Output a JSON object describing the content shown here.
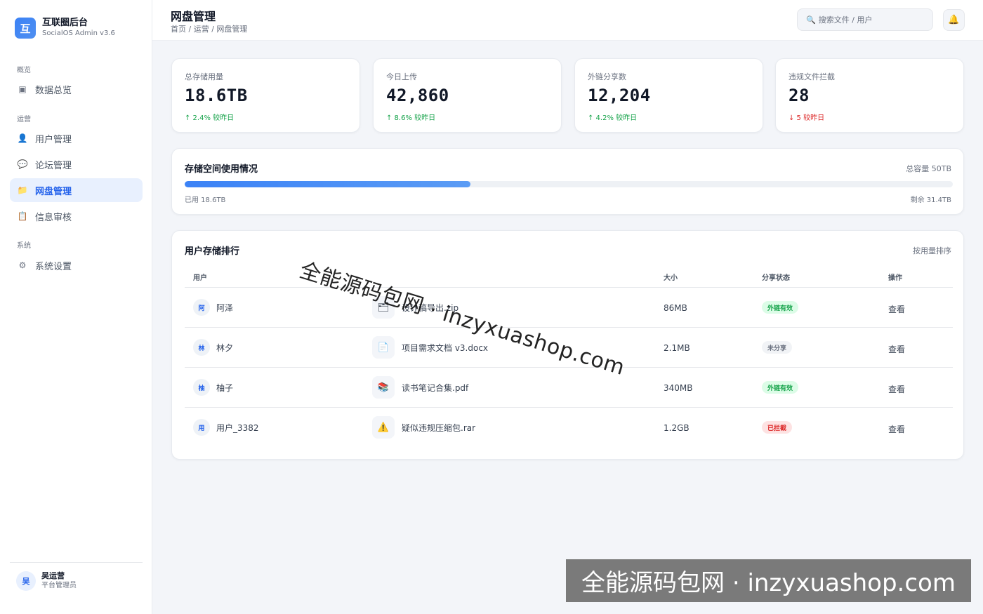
{
  "brand": {
    "logo_char": "互",
    "title": "互联圈后台",
    "subtitle": "SocialOS Admin v3.6"
  },
  "sidebar": {
    "groups": [
      {
        "label": "概览"
      },
      {
        "label": "运营"
      },
      {
        "label": "系统"
      }
    ],
    "items": [
      {
        "icon": "▣",
        "icon_name": "dashboard-icon",
        "label": "数据总览"
      },
      {
        "icon": "👤",
        "icon_name": "user-icon",
        "label": "用户管理"
      },
      {
        "icon": "💬",
        "icon_name": "forum-icon",
        "label": "论坛管理"
      },
      {
        "icon": "📁",
        "icon_name": "folder-icon",
        "label": "网盘管理"
      },
      {
        "icon": "📋",
        "icon_name": "clipboard-icon",
        "label": "信息审核"
      },
      {
        "icon": "⚙",
        "icon_name": "gear-icon",
        "label": "系统设置"
      }
    ],
    "active_item": "网盘管理"
  },
  "profile": {
    "avatar": "吴",
    "name": "吴运营",
    "role": "平台管理员"
  },
  "header": {
    "title": "网盘管理",
    "breadcrumb": "首页 / 运营 / 网盘管理",
    "search_placeholder": "搜索文件 / 用户",
    "search_icon": "🔍",
    "bell_icon": "🔔"
  },
  "stats": [
    {
      "label": "总存储用量",
      "value": "18.6TB",
      "delta": "↑ 2.4% 较昨日",
      "trend": "up"
    },
    {
      "label": "今日上传",
      "value": "42,860",
      "delta": "↑ 8.6% 较昨日",
      "trend": "up"
    },
    {
      "label": "外链分享数",
      "value": "12,204",
      "delta": "↑ 4.2% 较昨日",
      "trend": "up"
    },
    {
      "label": "违规文件拦截",
      "value": "28",
      "delta": "↓ 5 较昨日",
      "trend": "down"
    }
  ],
  "storage": {
    "title": "存储空间使用情况",
    "total": "总容量 50TB",
    "used": "已用 18.6TB",
    "remaining": "剩余 31.4TB",
    "used_fraction": 0.372
  },
  "ranking": {
    "title": "用户存储排行",
    "sort_label": "按用量排序",
    "columns": [
      "用户",
      "大小",
      "分享状态",
      "操作"
    ],
    "rows": [
      {
        "avatar": "阿",
        "user": "阿泽",
        "file_icon": "🗂",
        "file_icon_name": "archive-icon",
        "file": "设计稿导出.zip",
        "size": "86MB",
        "status": "外链有效",
        "status_type": "ok",
        "action": "查看"
      },
      {
        "avatar": "林",
        "user": "林夕",
        "file_icon": "📄",
        "file_icon_name": "document-icon",
        "file": "项目需求文档 v3.docx",
        "size": "2.1MB",
        "status": "未分享",
        "status_type": "none",
        "action": "查看"
      },
      {
        "avatar": "柚",
        "user": "柚子",
        "file_icon": "📚",
        "file_icon_name": "books-icon",
        "file": "读书笔记合集.pdf",
        "size": "340MB",
        "status": "外链有效",
        "status_type": "ok",
        "action": "查看"
      },
      {
        "avatar": "用",
        "user": "用户_3382",
        "file_icon": "⚠️",
        "file_icon_name": "warning-icon",
        "file": "疑似违规压缩包.rar",
        "size": "1.2GB",
        "status": "已拦截",
        "status_type": "blocked",
        "action": "查看"
      }
    ]
  },
  "watermark": {
    "text": "全能源码包网 · inzyxuashop.com"
  },
  "colors": {
    "accent": "#3b82f6",
    "up": "#16a34a",
    "down": "#dc2626",
    "background": "#f3f5f9"
  }
}
